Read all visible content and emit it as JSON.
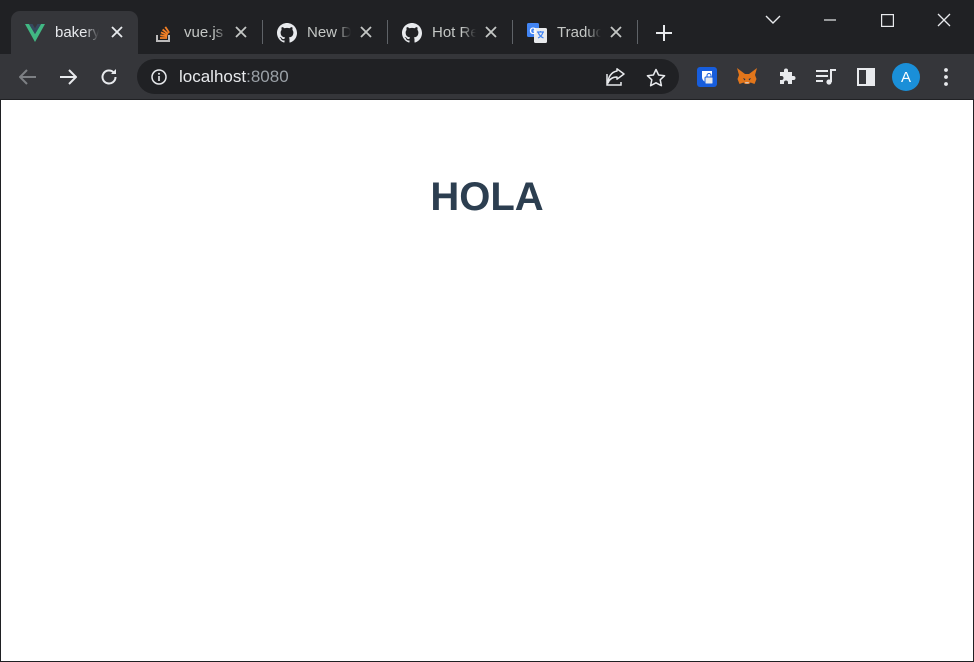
{
  "tabs": [
    {
      "title": "bakery",
      "favicon": "vue-logo-icon",
      "active": true
    },
    {
      "title": "vue.js - Stack Overflow",
      "favicon": "stackoverflow-icon",
      "active": false
    },
    {
      "title": "New Discussion",
      "favicon": "github-icon",
      "active": false
    },
    {
      "title": "Hot Reload",
      "favicon": "github-icon",
      "active": false
    },
    {
      "title": "Traductor",
      "favicon": "google-translate-icon",
      "active": false
    }
  ],
  "address_bar": {
    "host": "localhost",
    "port": ":8080"
  },
  "page": {
    "heading": "HOLA"
  },
  "profile": {
    "initial": "A",
    "color": "#1a8fd8"
  },
  "theme": {
    "tabstrip": "#202124",
    "toolbar": "#35363a",
    "heading_color": "#2c3e50",
    "vue_green": "#41b883",
    "stackoverflow_orange": "#f48024"
  }
}
